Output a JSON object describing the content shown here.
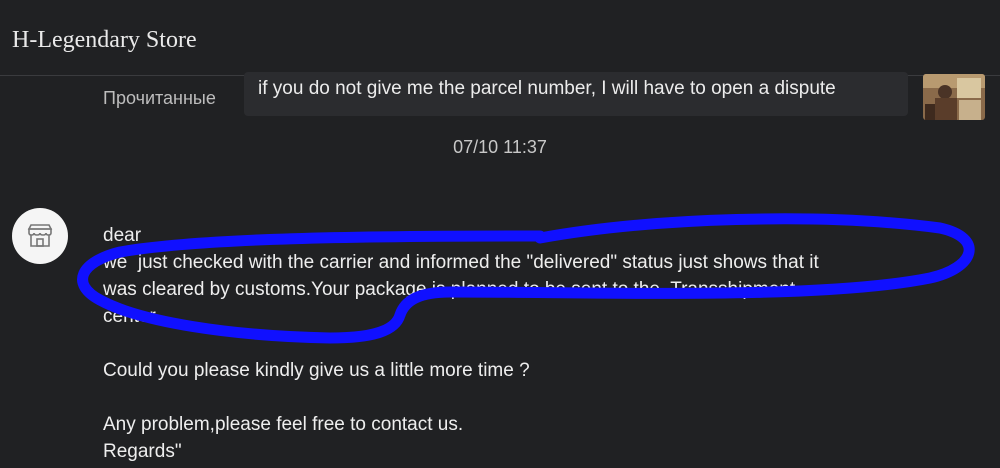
{
  "header": {
    "title": "H-Legendary Store"
  },
  "chat": {
    "read_status": "Прочитанные",
    "my_message": "if you do not give me the parcel number, I will have to open a dispute",
    "timestamp": "07/10 11:37",
    "seller_message": {
      "lines": [
        "dear",
        "we  just checked with the carrier and informed the \"delivered\" status just shows that it",
        "was cleared by customs.Your package is planned to be sent to the  Transshipment",
        "center。",
        "Could you please kindly give us a little more time ?",
        "Any problem,please feel free to contact us.",
        "Regards\""
      ]
    }
  },
  "icons": {
    "shop_avatar": "store-icon",
    "user_avatar": "user-photo"
  },
  "colors": {
    "background": "#202123",
    "bubble": "#2b2c2f",
    "annotation": "#1010ff"
  }
}
